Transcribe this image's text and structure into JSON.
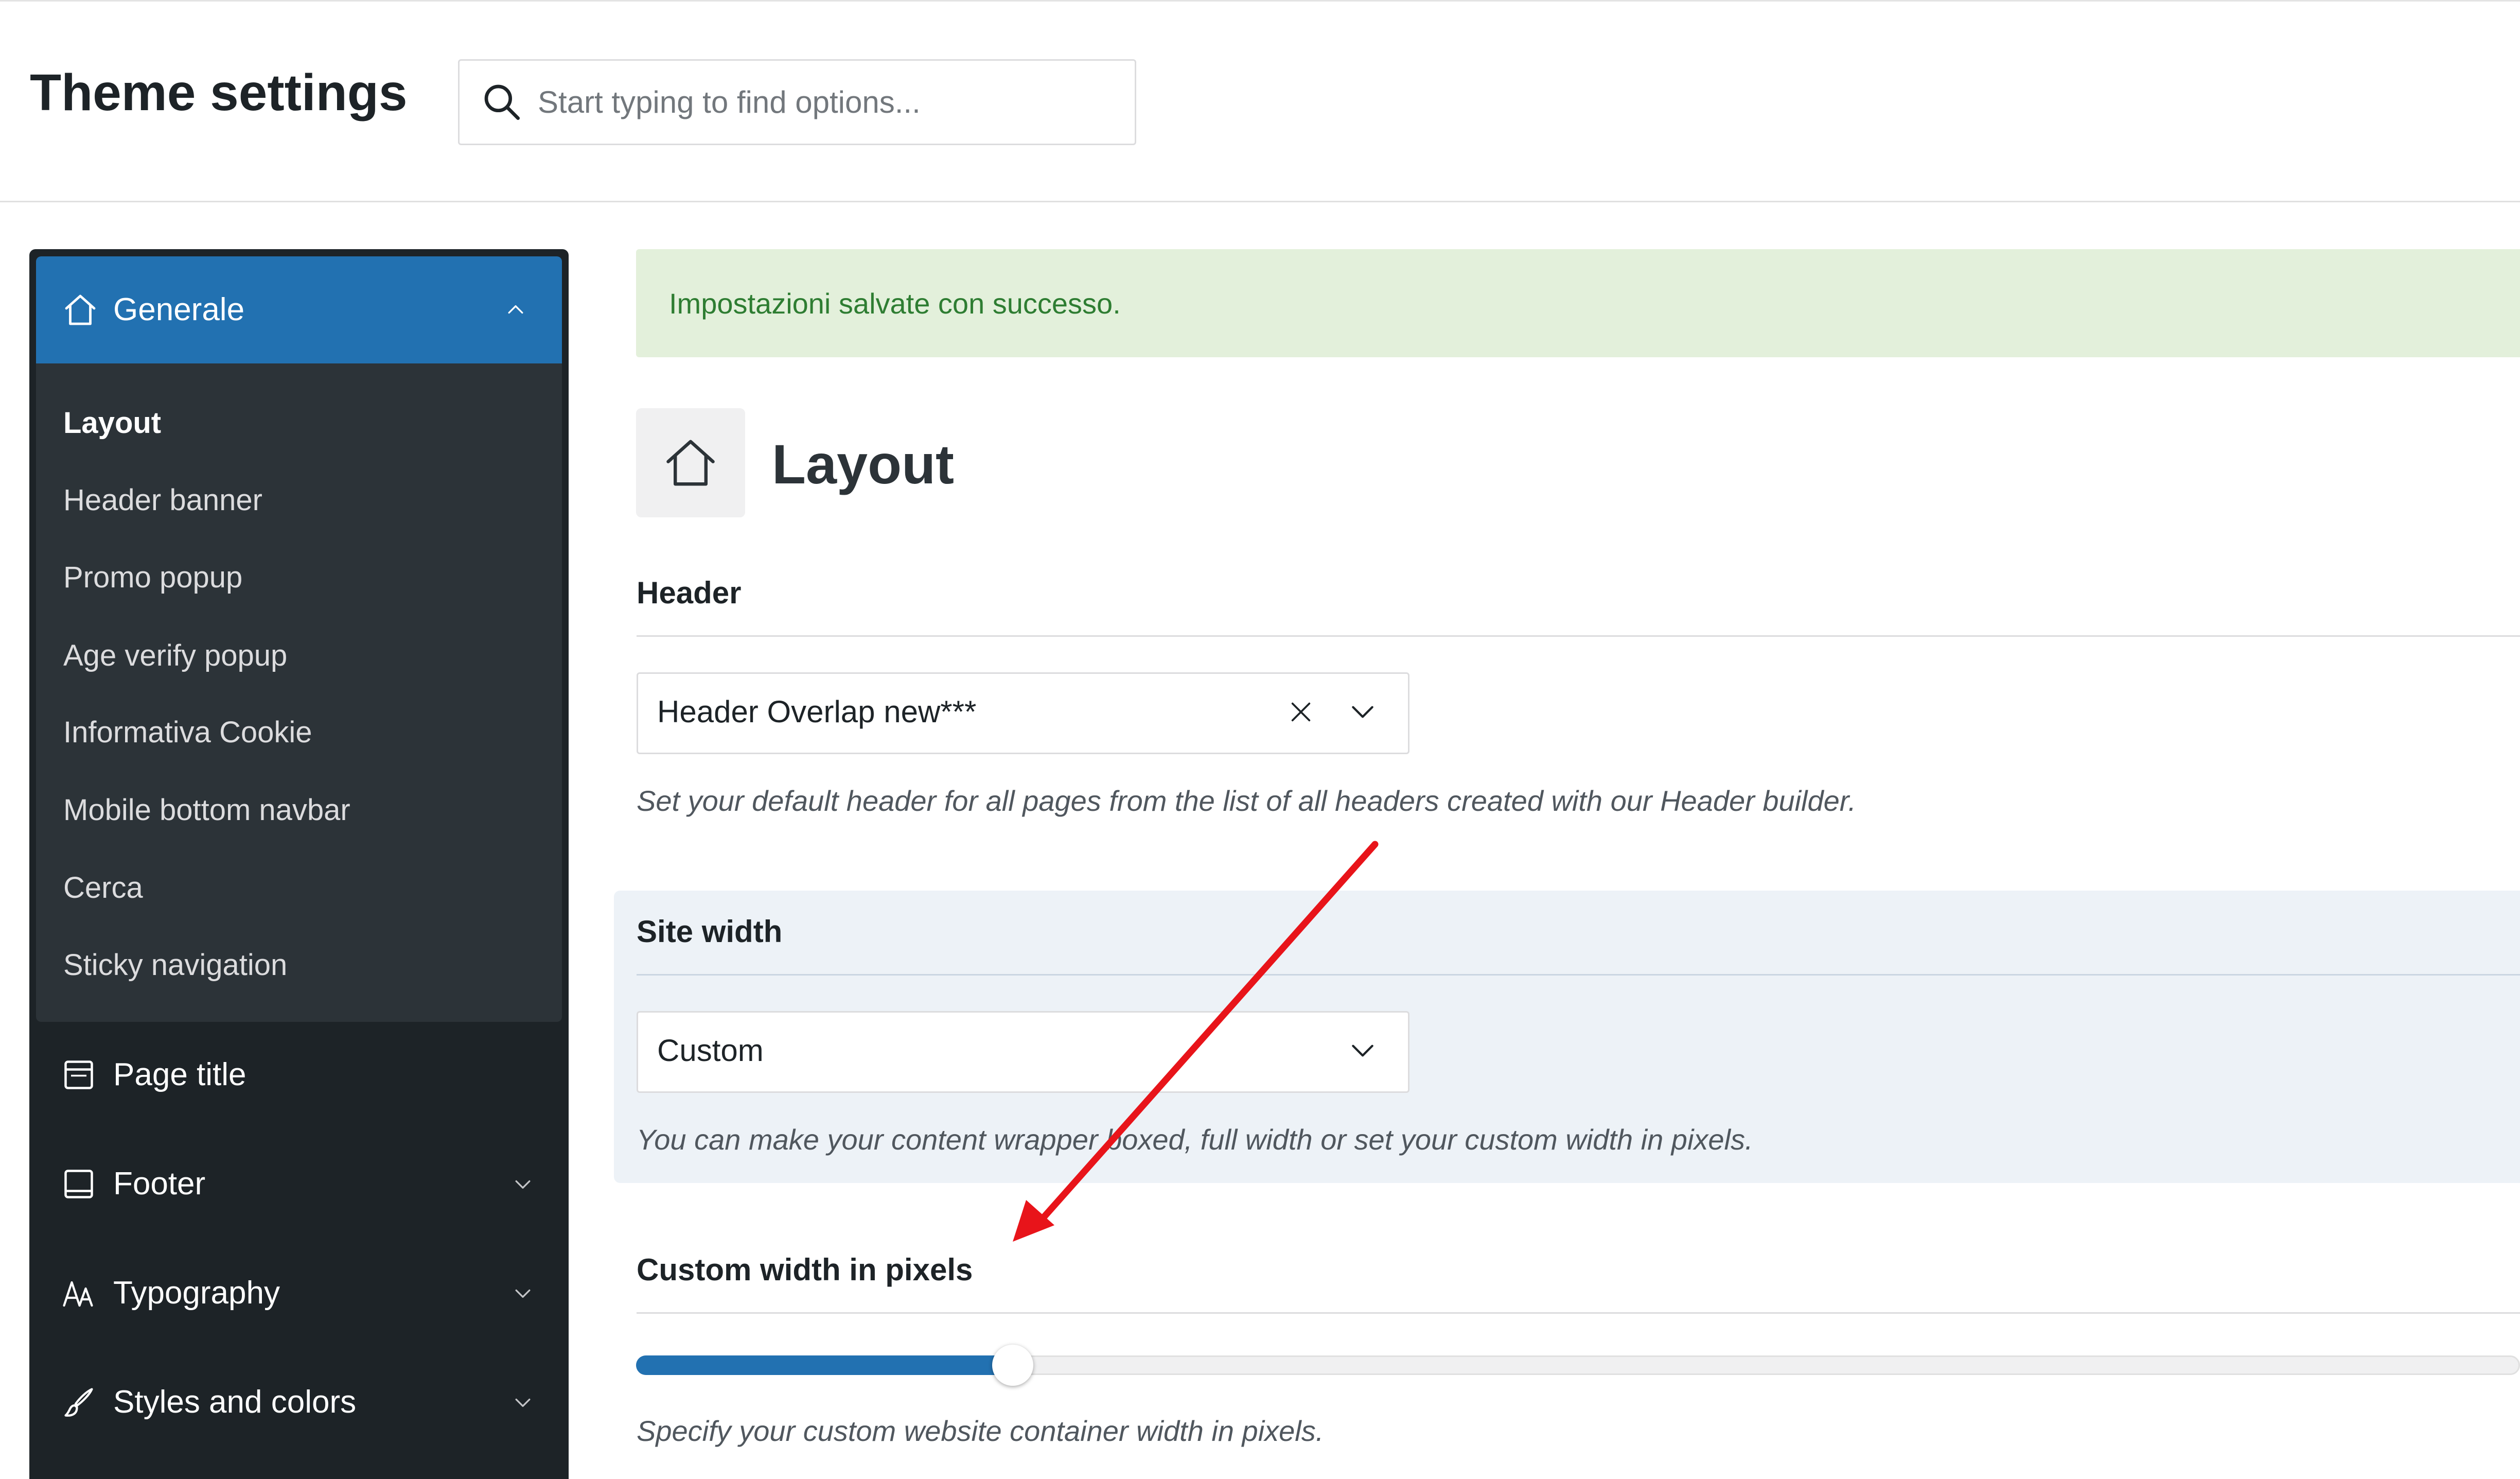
{
  "header": {
    "title": "Theme settings",
    "search_placeholder": "Start typing to find options..."
  },
  "sidebar": {
    "section": {
      "label": "Generale",
      "icon": "home-icon",
      "expanded": true,
      "items": [
        {
          "label": "Layout",
          "active": true
        },
        {
          "label": "Header banner"
        },
        {
          "label": "Promo popup"
        },
        {
          "label": "Age verify popup"
        },
        {
          "label": "Informativa Cookie"
        },
        {
          "label": "Mobile bottom navbar"
        },
        {
          "label": "Cerca"
        },
        {
          "label": "Sticky navigation"
        }
      ]
    },
    "items": [
      {
        "label": "Page title",
        "icon": "page-title-icon",
        "expandable": false
      },
      {
        "label": "Footer",
        "icon": "footer-icon",
        "expandable": true
      },
      {
        "label": "Typography",
        "icon": "typography-icon",
        "expandable": true
      },
      {
        "label": "Styles and colors",
        "icon": "brush-icon",
        "expandable": true
      }
    ]
  },
  "notice": {
    "text": "Impostazioni salvate con successo.",
    "type": "success"
  },
  "main": {
    "section_title": "Layout",
    "section_icon": "home-icon",
    "header_field": {
      "label": "Header",
      "value": "Header Overlap new***",
      "help": "Set your default header for all pages from the list of all headers created with our Header builder."
    },
    "site_width_field": {
      "label": "Site width",
      "value": "Custom",
      "help": "You can make your content wrapper boxed, full width or set your custom width in pixels."
    },
    "custom_width_field": {
      "label": "Custom width in pixels",
      "slider_fraction": 0.2,
      "help": "Specify your custom website container width in pixels."
    }
  },
  "colors": {
    "accent": "#2271b1",
    "sidebar_bg": "#1d2327",
    "submenu_bg": "#2c3338",
    "notice_bg": "#e3f0db",
    "notice_text": "#2e7d32",
    "panel_highlight": "#edf2f7",
    "annotation_arrow": "#e8141a"
  }
}
